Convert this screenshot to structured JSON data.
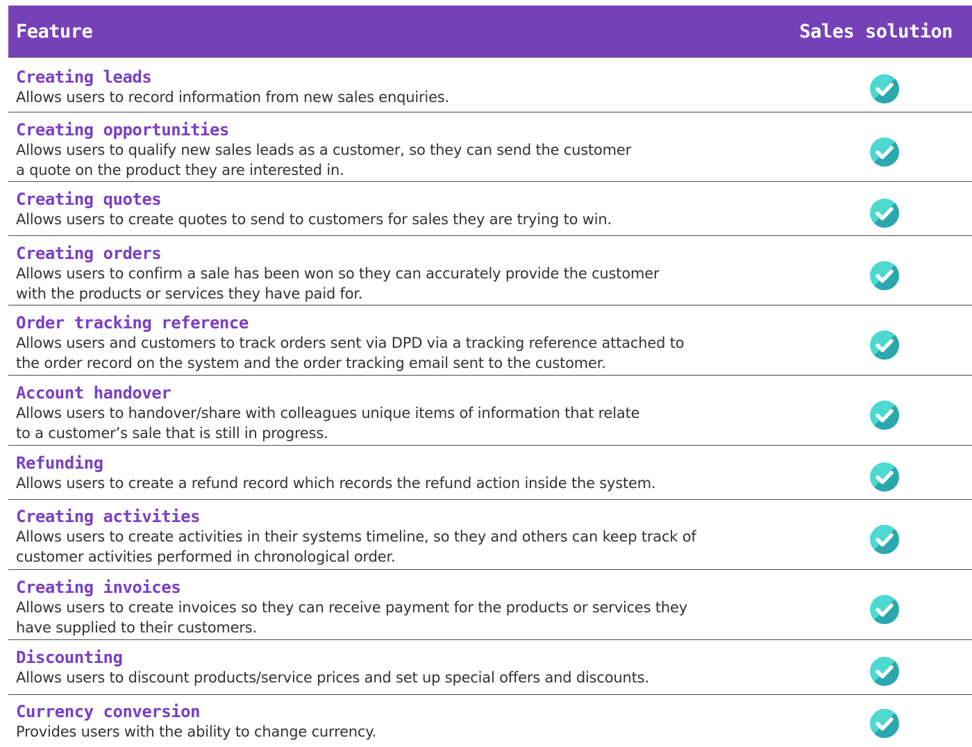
{
  "header": {
    "feature_label": "Feature",
    "solution_label": "Sales solution"
  },
  "colors": {
    "header_bg": "#7641b8",
    "title_color": "#7a3fc4",
    "check_light": "#4dd9d0",
    "check_dark": "#2aa8ad"
  },
  "rows": [
    {
      "title": "Creating leads",
      "lines": [
        "Allows users to record information from new sales enquiries."
      ],
      "included_icon": "check-circle-icon"
    },
    {
      "title": "Creating opportunities",
      "lines": [
        "Allows users to qualify new sales leads as a customer, so they can send the customer",
        "a quote on the product they are interested in."
      ],
      "included_icon": "check-circle-icon"
    },
    {
      "title": "Creating quotes",
      "lines": [
        "Allows users to create quotes to send to customers for sales they are trying to win."
      ],
      "included_icon": "check-circle-icon"
    },
    {
      "title": "Creating orders",
      "lines": [
        "Allows users to confirm a sale has been won so they can accurately provide the customer",
        "with the products or services they have paid for."
      ],
      "included_icon": "check-circle-icon"
    },
    {
      "title": "Order tracking reference",
      "lines": [
        "Allows users and customers to track orders sent via DPD via a tracking reference attached to",
        "the order record on the system and the order tracking email sent to the customer."
      ],
      "included_icon": "check-circle-icon"
    },
    {
      "title": "Account handover",
      "lines": [
        "Allows users to handover/share with colleagues unique items of information that relate",
        "to a customer’s sale that is still in progress."
      ],
      "included_icon": "check-circle-icon"
    },
    {
      "title": "Refunding",
      "lines": [
        "Allows users to create a refund record which records the refund action inside the system."
      ],
      "included_icon": "check-circle-icon"
    },
    {
      "title": "Creating activities",
      "lines": [
        "Allows users to create activities in their systems timeline, so they and others can keep track of",
        "customer activities performed in chronological order."
      ],
      "included_icon": "check-circle-icon"
    },
    {
      "title": "Creating invoices",
      "lines": [
        "Allows users to create invoices so they can receive payment for the products or services they",
        "have supplied to their customers."
      ],
      "included_icon": "check-circle-icon"
    },
    {
      "title": "Discounting",
      "lines": [
        "Allows users to discount products/service prices and set up special offers and discounts."
      ],
      "included_icon": "check-circle-icon"
    },
    {
      "title": "Currency conversion",
      "lines": [
        "Provides users with the ability to change currency."
      ],
      "included_icon": "check-circle-icon"
    }
  ]
}
